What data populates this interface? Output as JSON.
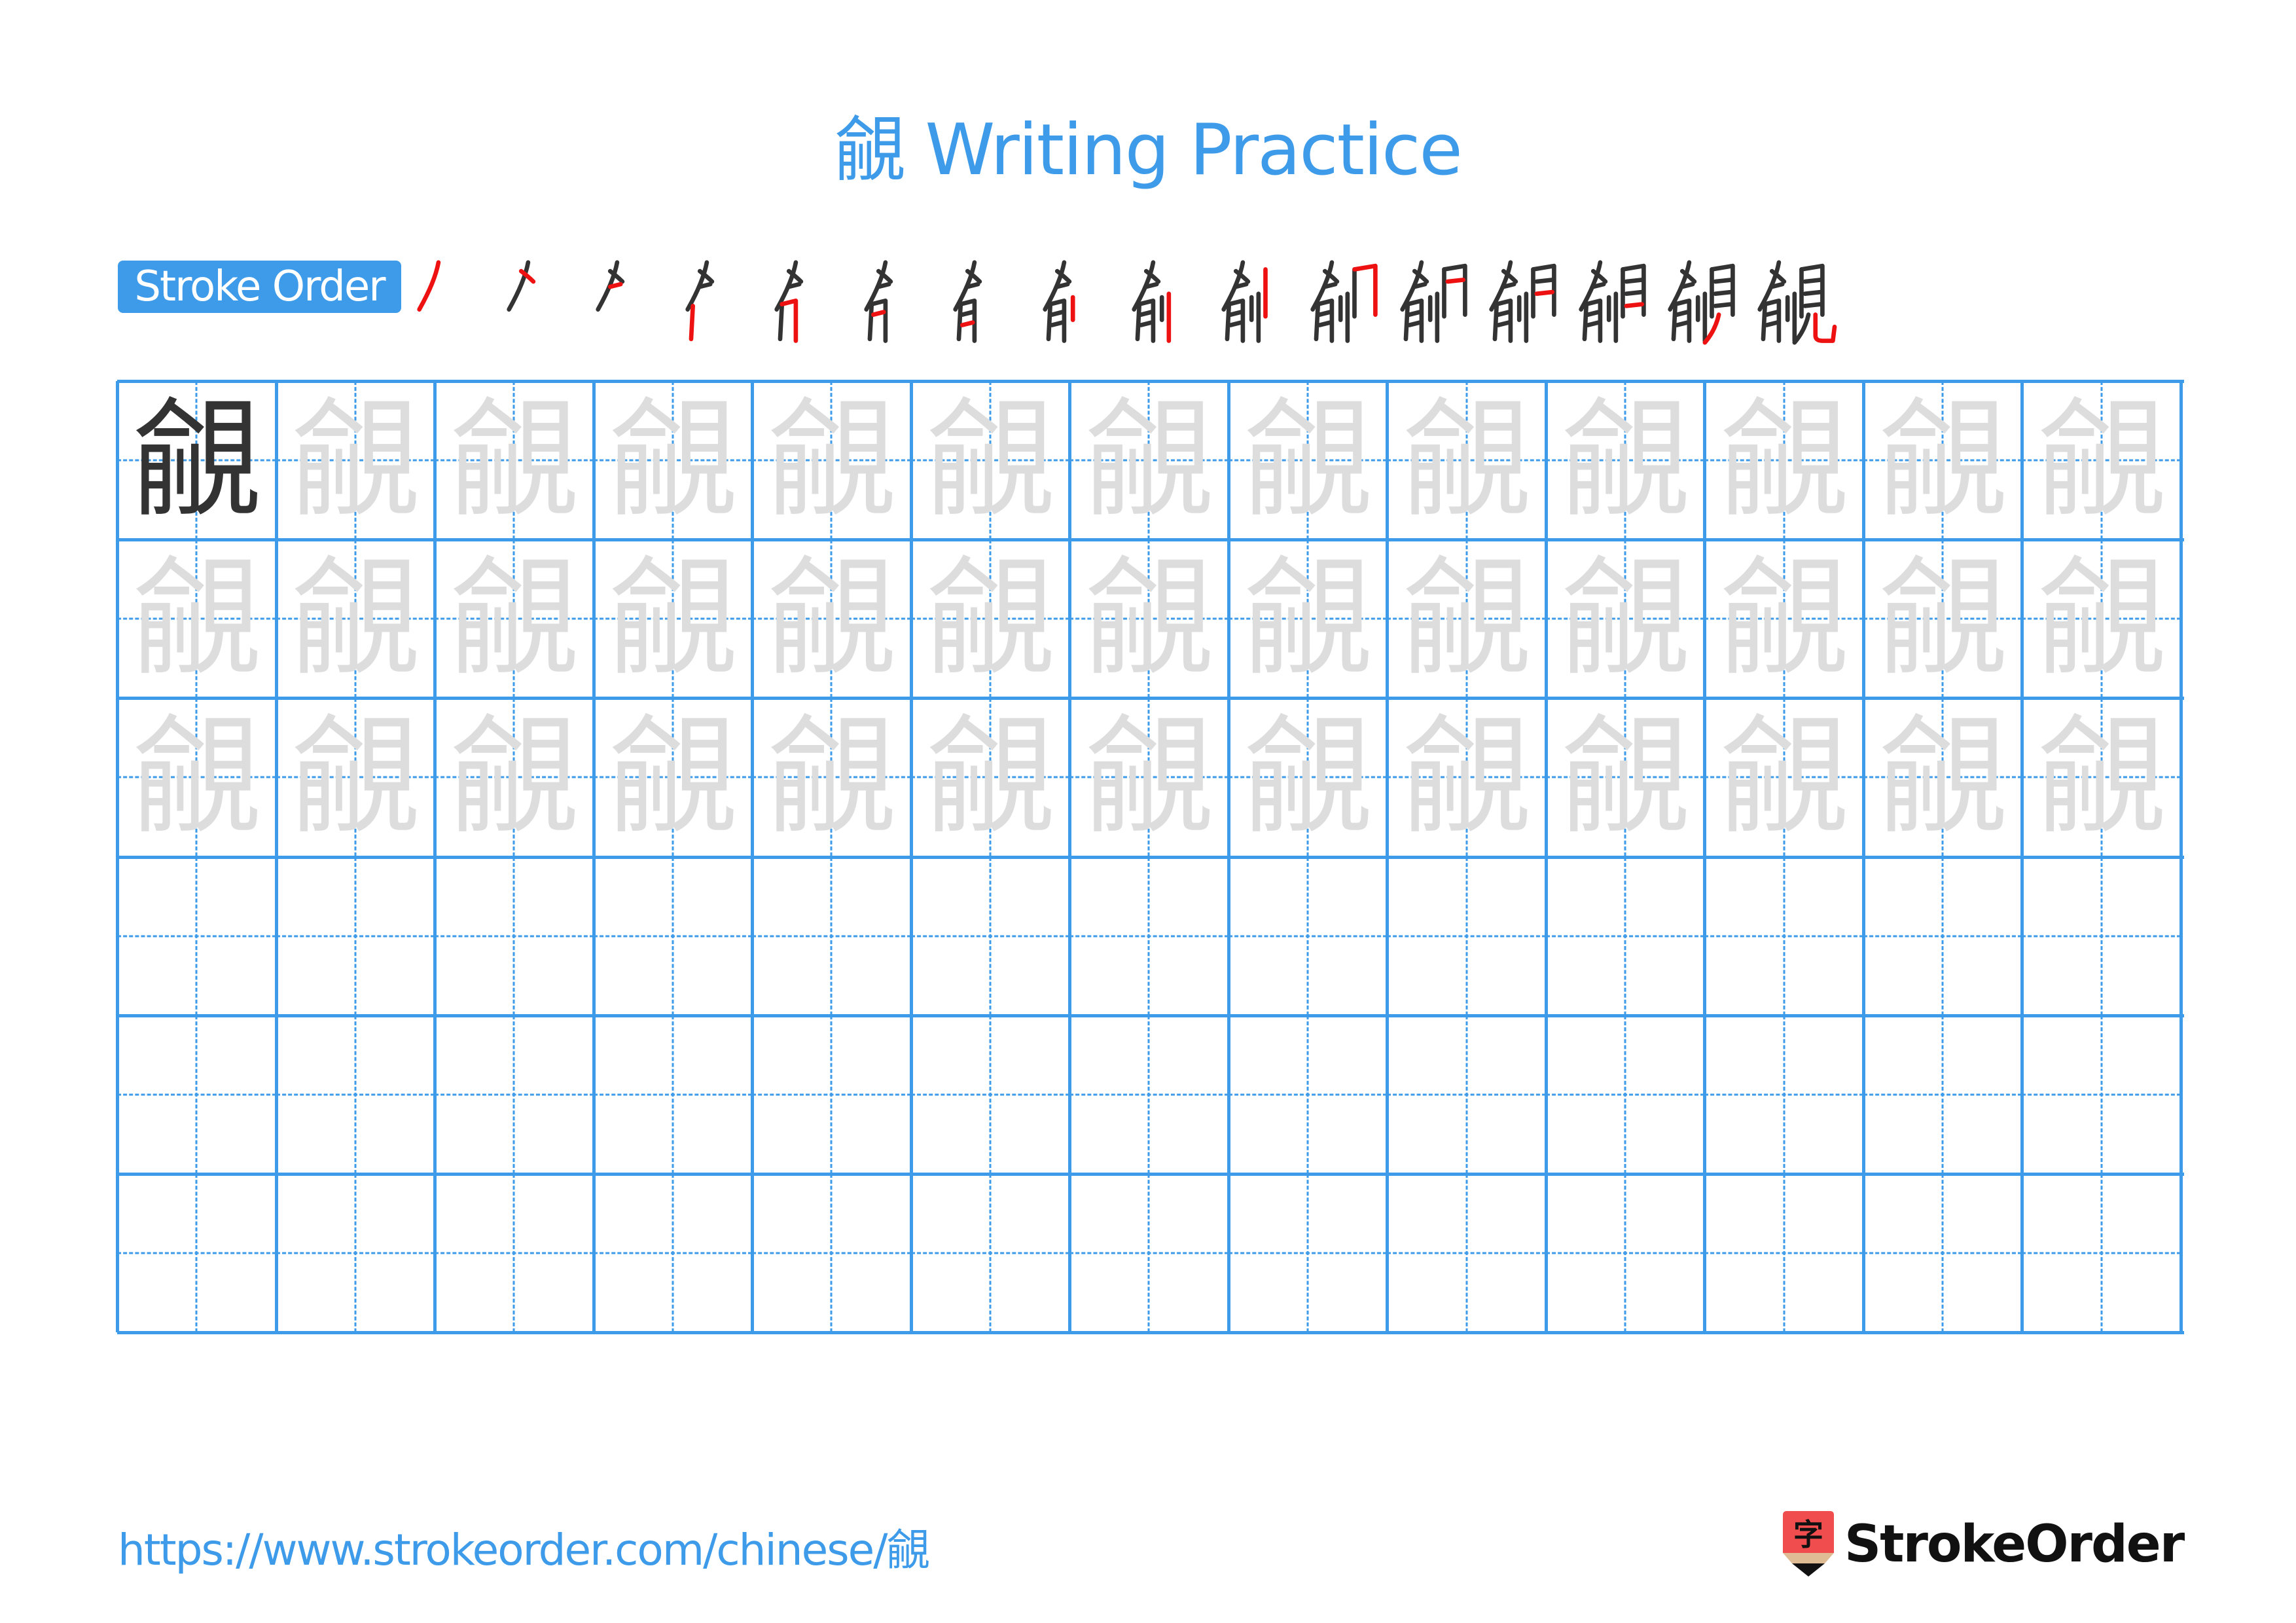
{
  "page": {
    "title": "覦 Writing Practice",
    "character": "覦",
    "stroke_order_label": "Stroke Order",
    "stroke_count": 16,
    "grid": {
      "columns": 13,
      "rows": 6,
      "model_cells": 1,
      "ghost_rows": 3,
      "empty_rows": 3
    },
    "footer": {
      "url": "https://www.strokeorder.com/chinese/覦",
      "logo_text": "StrokeOrder",
      "logo_icon_char": "字"
    },
    "colors": {
      "accent": "#3d9be9",
      "model_glyph": "#333333",
      "ghost_glyph": "#dddddd",
      "highlight_stroke": "#ee1111",
      "logo_red": "#f04e4e",
      "logo_wood": "#e0bc94",
      "logo_tip": "#111111"
    }
  }
}
